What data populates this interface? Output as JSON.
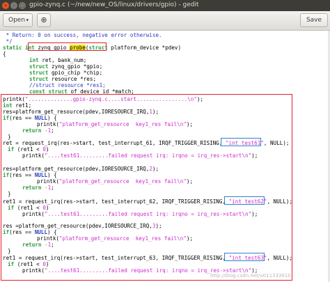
{
  "window": {
    "title": "gpio-zynq.c (~/new/new_OS/linux/drivers/gpio) - gedit",
    "close_glyph": "×",
    "min_glyph": "–",
    "max_glyph": "□"
  },
  "toolbar": {
    "open_label": "Open",
    "open_chevron": "▾",
    "new_tab_glyph": "⊕",
    "save_label": "Save"
  },
  "code": {
    "l01": " * Return: 0 on success, negative error otherwise.",
    "l02": " */",
    "l03_static": "static",
    "l03_int": "int",
    "l03_fn_a": "zynq_gpio_",
    "l03_fn_b": "probe",
    "l03_struct": "struct",
    "l03_rest": " platform_device *pdev)",
    "l04": "{",
    "l05_int": "int",
    "l05_rest": " ret, bank_num;",
    "l06_struct": "struct",
    "l06_rest": " zynq_gpio *gpio;",
    "l07_struct": "struct",
    "l07_rest": " gpio_chip *chip;",
    "l08_struct": "struct",
    "l08_rest": " resource *res;",
    "l09_cmt": "//struct resource *res1;",
    "l10_const": "const",
    "l10_struct": "struct",
    "l10_rest": " of_device_id *match;",
    "l11_a": "printk(",
    "l11_str": "\"..............gpio-zynq.c....start................\\n\"",
    "l11_b": ");",
    "l12_int": "int",
    "l12_rest": " ret1;",
    "l13_a": "res=platform_get_resource(pdev,IORESOURCE_IRQ,",
    "l13_num": "1",
    "l13_b": ");",
    "l14_if": "if",
    "l14_a": "(res == ",
    "l14_null": "NULL",
    "l14_b": ") {",
    "l15_a": "printk(",
    "l15_str": "\"platform_get_resource  key1_res fail\\n\"",
    "l15_b": ");",
    "l16_ret": "return",
    "l16_num": "-1",
    "l16_b": ";",
    "l17": "}",
    "l18_a": "ret = request_irq(res->start, test_interrupt_61, IRQF_TRIGGER_RISING, ",
    "l18_str": "\"int_test61\"",
    "l18_b": ", NULL);",
    "l19_if": "if",
    "l19_a": " (ret1 < ",
    "l19_num": "0",
    "l19_b": ")",
    "l20_a": "printk(",
    "l20_str": "\"....test61.........failed request irq: irqno = irq_res->start\\n\"",
    "l20_b": ");",
    "l21_a": "res=platform_get_resource(pdev,IORESOURCE_IRQ,",
    "l21_num": "2",
    "l21_b": ");",
    "l22_if": "if",
    "l22_a": "(res == ",
    "l22_null": "NULL",
    "l22_b": ") {",
    "l23_a": "printk(",
    "l23_str": "\"platform_get_resource  key1_res fail\\n\"",
    "l23_b": ");",
    "l24_ret": "return",
    "l24_num": "-1",
    "l24_b": ";",
    "l25": "}",
    "l26_a": "ret1 = request_irq(res->start, test_interrupt_62, IRQF_TRIGGER_RISING, ",
    "l26_str": "\"int_test62\"",
    "l26_b": ", NULL);",
    "l27_if": "if",
    "l27_a": " (ret1 < ",
    "l27_num": "0",
    "l27_b": ")",
    "l28_a": "printk(",
    "l28_str": "\"....test61.........failed request irq: irqno = irq_res->start\\n\"",
    "l28_b": ");",
    "l29_a": "res =platform_get_resource(pdev,IORESOURCE_IRQ,",
    "l29_num": "3",
    "l29_b": ");",
    "l30_if": "if",
    "l30_a": "(res == ",
    "l30_null": "NULL",
    "l30_b": ") {",
    "l31_a": "printk(",
    "l31_str": "\"platform_get_resource  key1_res fail\\n\"",
    "l31_b": ");",
    "l32_ret": "return",
    "l32_num": "-1",
    "l32_b": ";",
    "l33": "}",
    "l34_a": "ret1 = request_irq(res->start, test_interrupt_63, IRQF_TRIGGER_RISING, ",
    "l34_str": "\"int_test63\"",
    "l34_b": ", NULL);",
    "l35_if": "if",
    "l35_a": " (ret1 < ",
    "l35_num": "0",
    "l35_b": ")",
    "l36_a": "printk(",
    "l36_str": "\"....test61.........failed request irq: irqno = irq_res->start\\n\"",
    "l36_b": ");"
  },
  "watermark": "http://blog.csdn.net/u011333610",
  "colors": {
    "annotation_red": "#e0202a",
    "annotation_blue": "#2d7fd3",
    "highlight_yellow": "#f5e21a",
    "titlebar": "#3d3c37"
  }
}
